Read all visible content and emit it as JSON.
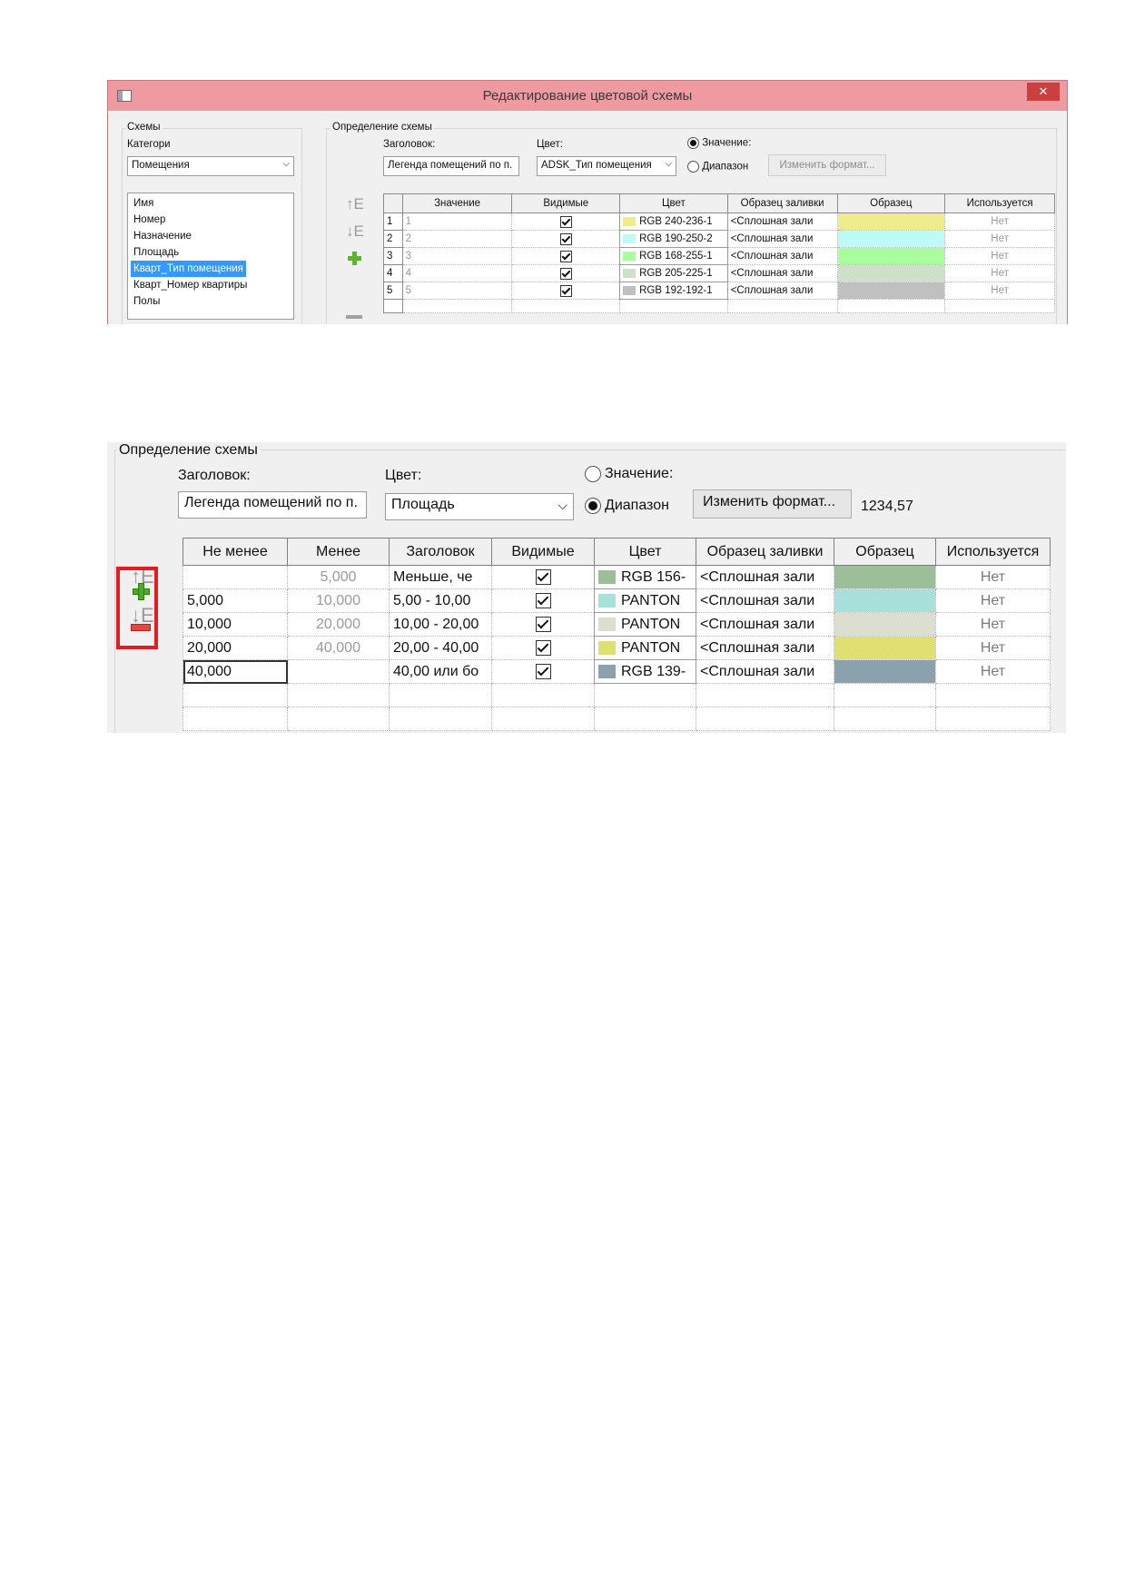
{
  "dialog": {
    "title": "Редактирование цветовой схемы",
    "close_glyph": "✕",
    "schemes": {
      "group_label": "Схемы",
      "category_label": "Категори",
      "category_value": "Помещения",
      "parameters": [
        "Имя",
        "Номер",
        "Назначение",
        "Площадь",
        "Кварт_Тип помещения",
        "Кварт_Номер квартиры",
        "Полы"
      ],
      "selected_parameter": "Кварт_Тип помещения"
    },
    "definition": {
      "group_label": "Определение схемы",
      "heading_label": "Заголовок:",
      "heading_value": "Легенда помещений по п.",
      "color_label": "Цвет:",
      "color_value": "ADSK_Тип помещения",
      "radio_value": "Значение:",
      "radio_range": "Диапазон",
      "format_button": "Изменить формат...",
      "columns": [
        "Значение",
        "Видимые",
        "Цвет",
        "Образец заливки",
        "Образец",
        "Используется"
      ],
      "rows": [
        {
          "n": "1",
          "value": "1",
          "color": "RGB 240-236-1",
          "swatch": "#f0ec8e",
          "fill": "<Сплошная зали",
          "used": "Нет"
        },
        {
          "n": "2",
          "value": "2",
          "color": "RGB 190-250-2",
          "swatch": "#befaf6",
          "fill": "<Сплошная зали",
          "used": "Нет"
        },
        {
          "n": "3",
          "value": "3",
          "color": "RGB 168-255-1",
          "swatch": "#a8ff9e",
          "fill": "<Сплошная зали",
          "used": "Нет"
        },
        {
          "n": "4",
          "value": "4",
          "color": "RGB 205-225-1",
          "swatch": "#cde1c8",
          "fill": "<Сплошная зали",
          "used": "Нет"
        },
        {
          "n": "5",
          "value": "5",
          "color": "RGB 192-192-1",
          "swatch": "#c0c0c0",
          "fill": "<Сплошная зали",
          "used": "Нет"
        }
      ]
    }
  },
  "zoom": {
    "group_label": "Определение схемы",
    "heading_label": "Заголовок:",
    "heading_value": "Легенда помещений по п.",
    "color_label": "Цвет:",
    "color_value": "Площадь",
    "radio_value": "Значение:",
    "radio_range": "Диапазон",
    "format_button": "Изменить формат...",
    "format_sample": "1234,57",
    "columns": [
      "Не менее",
      "Менее",
      "Заголовок",
      "Видимые",
      "Цвет",
      "Образец заливки",
      "Образец",
      "Используется"
    ],
    "rows": [
      {
        "min": "",
        "max": "5,000",
        "caption": "Меньше, че",
        "color": "RGB 156-",
        "swatch": "#9cbf99",
        "fill": "<Сплошная зали",
        "used": "Нет"
      },
      {
        "min": "5,000",
        "max": "10,000",
        "caption": "5,00 - 10,00",
        "color": "PANTON",
        "swatch": "#a8e0dc",
        "fill": "<Сплошная зали",
        "used": "Нет"
      },
      {
        "min": "10,000",
        "max": "20,000",
        "caption": "10,00 - 20,00",
        "color": "PANTON",
        "swatch": "#dcdfd0",
        "fill": "<Сплошная зали",
        "used": "Нет"
      },
      {
        "min": "20,000",
        "max": "40,000",
        "caption": "20,00 - 40,00",
        "color": "PANTON",
        "swatch": "#e0df72",
        "fill": "<Сплошная зали",
        "used": "Нет"
      },
      {
        "min": "40,000",
        "max": "",
        "caption": "40,00 или бо",
        "color": "RGB 139-",
        "swatch": "#8ba1ad",
        "fill": "<Сплошная зали",
        "used": "Нет"
      }
    ],
    "highlight_color": "#e31b23"
  }
}
